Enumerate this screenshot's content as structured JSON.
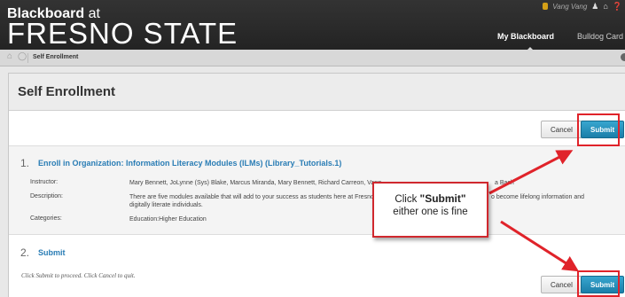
{
  "header": {
    "logo_top": "Blackboard",
    "logo_top_suffix": "at",
    "logo_main": "FRESNO STATE",
    "user_name": "Vang Vang",
    "tabs": {
      "my_blackboard": "My Blackboard",
      "bulldog_card": "Bulldog Card"
    }
  },
  "breadcrumb": {
    "current": "Self Enrollment"
  },
  "page": {
    "title": "Self Enrollment"
  },
  "buttons": {
    "cancel": "Cancel",
    "submit": "Submit"
  },
  "step1": {
    "number": "1.",
    "title": "Enroll in Organization: Information Literacy Modules (ILMs) (Library_Tutorials.1)",
    "instructor_label": "Instructor:",
    "instructor_value": "Mary Bennett, JoLynne (Sys) Blake, Marcus Miranda, Mary Bennett, Richard Carreon, Vang",
    "instructor_tail": "a Bach",
    "description_label": "Description:",
    "description_value": "There are five modules available that will add to your success as students here at Fresno",
    "description_tail": "o become lifelong information and",
    "description_value2": "digitally literate individuals.",
    "categories_label": "Categories:",
    "categories_value": "Education:Higher Education"
  },
  "step2": {
    "number": "2.",
    "title": "Submit",
    "description": "Click Submit to proceed. Click Cancel to quit."
  },
  "callout": {
    "prefix": "Click",
    "emphasis": "\"Submit\"",
    "line2": "either one is fine"
  },
  "colors": {
    "accent": "#2a7db5",
    "highlight": "#e0232a",
    "submit": "#1b7ea8"
  }
}
